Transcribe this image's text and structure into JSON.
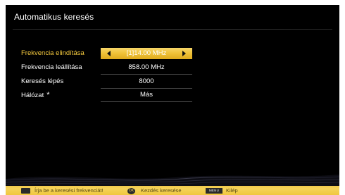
{
  "header": {
    "title": "Automatikus keresés"
  },
  "settings": [
    {
      "label": "Frekvencia elindítása",
      "value": "[1]14.00 MHz",
      "selected": true
    },
    {
      "label": "Frekvencia leállítása",
      "value": "858.00 MHz",
      "selected": false
    },
    {
      "label": "Keresés lépés",
      "value": "8000",
      "selected": false
    },
    {
      "label": "Hálózat",
      "value": "Más",
      "selected": false,
      "label_suffix": "*"
    }
  ],
  "footer": {
    "digits_hint": "Írja be a keresési frekvenciát!",
    "ok_icon_label": "OK",
    "ok_hint": "Kezdés keresése",
    "menu_icon_label": "MENU",
    "menu_hint": "Kilép"
  },
  "colors": {
    "screen_background": "#000000",
    "selected_label": "#f4c93e",
    "selected_bar": "#f0c33a",
    "footer_bar": "#f3cd4f"
  },
  "icons": {
    "left": "arrow-left-icon",
    "right": "arrow-right-icon",
    "star": "star-icon",
    "digits": "number-keys-icon",
    "ok": "ok-button-icon",
    "menu": "menu-button-icon"
  }
}
